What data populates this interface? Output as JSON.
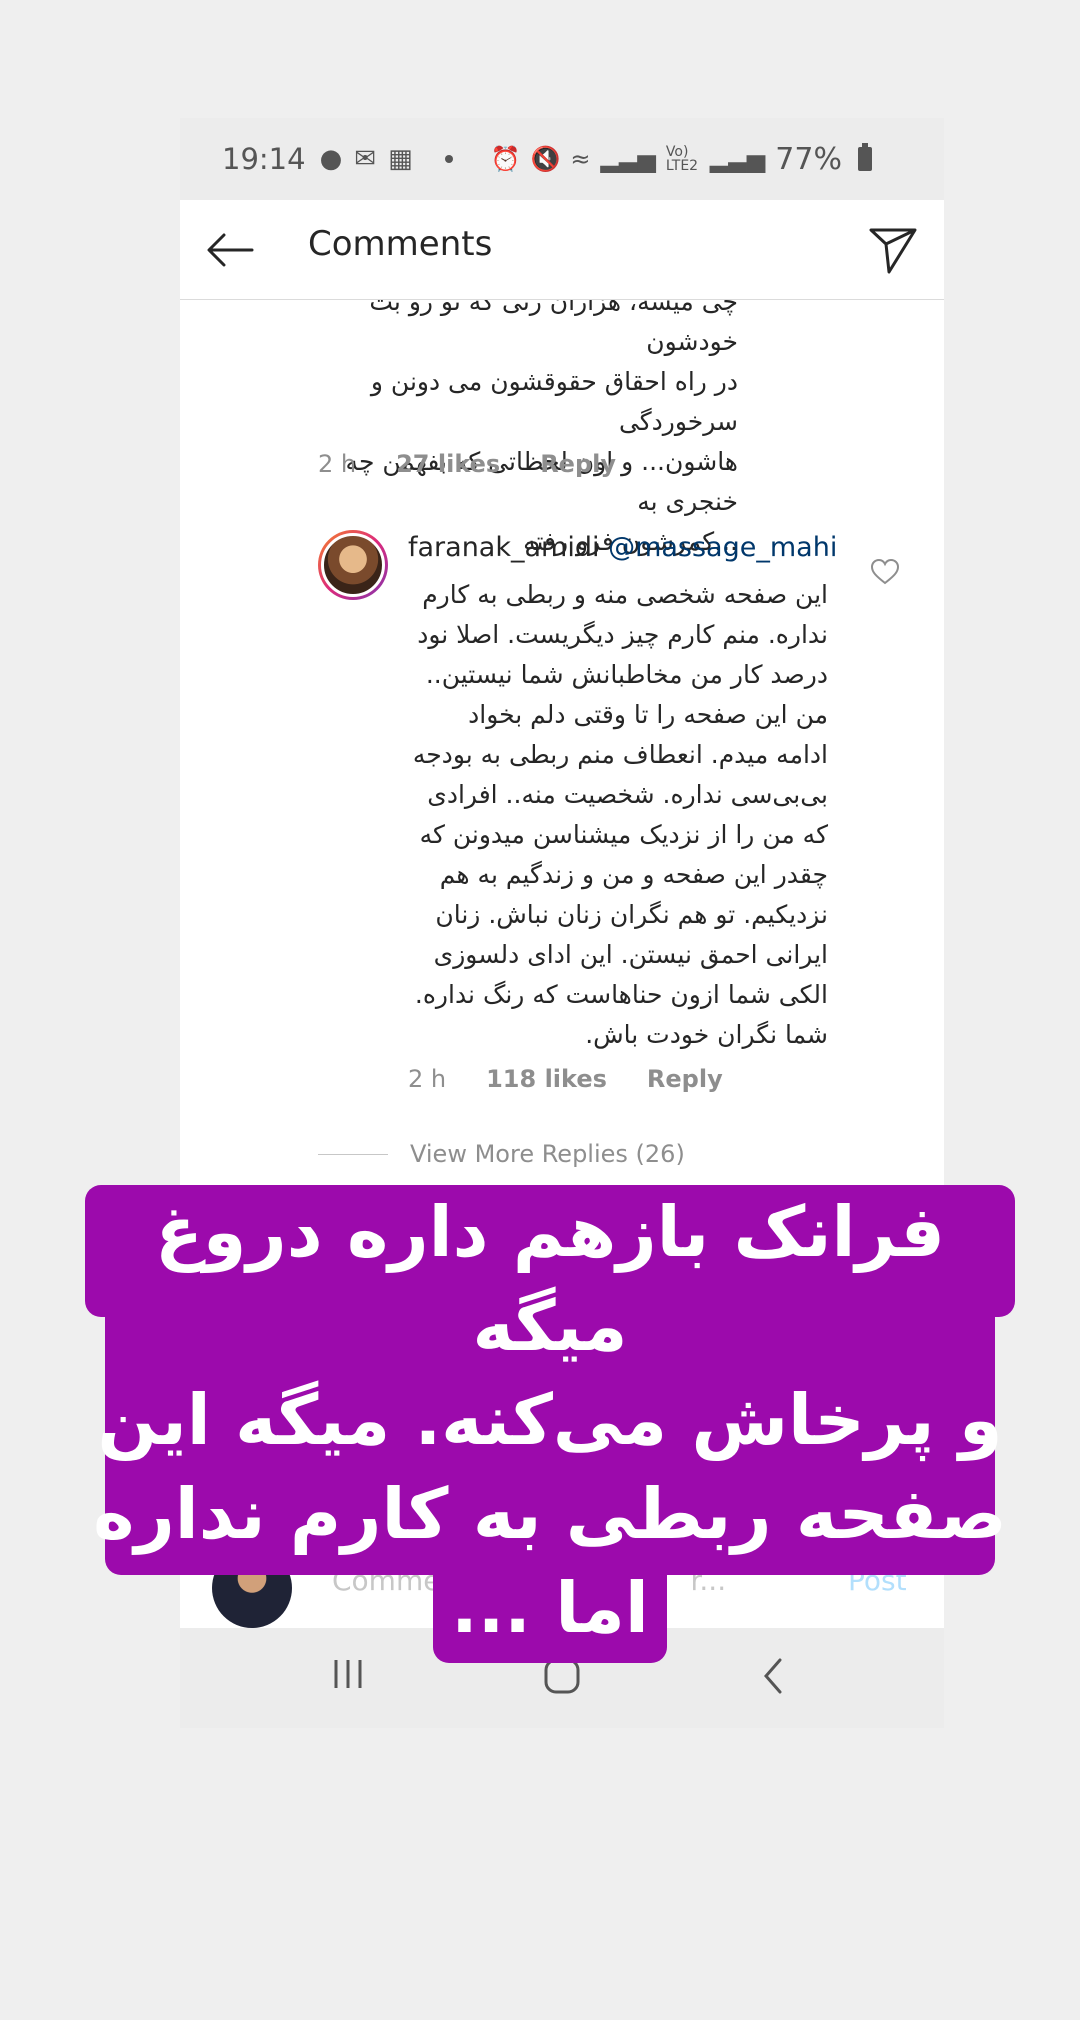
{
  "status_bar": {
    "time": "19:14",
    "battery_percent": "77%",
    "network_label": "Vo) LTE2"
  },
  "header": {
    "title": "Comments"
  },
  "previous_comment": {
    "lines": [
      "چی میشه، هزاران زنی که تو رو بت خودشون",
      "در راه احقاق حقوقشون می دونن و سرخوردگی",
      "هاشون... و اون لحظاتی که بفهمن چه خنجری به",
      "...کمرشون فرو رفته"
    ],
    "time": "2 h",
    "likes": "27 likes",
    "reply_label": "Reply"
  },
  "reply_comment": {
    "username": "faranak_amidi",
    "mention": "@massage_mahi",
    "lines": [
      "این صفحه شخصی منه و ربطی به کارم",
      "نداره. منم کارم چیز دیگریست. اصلا نود",
      "درصد کار من مخاطبانش شما نیستین..",
      "من این صفحه را تا وقتی دلم بخواد",
      "ادامه میدم.  انعطاف منم ربطی به بودجه",
      "بی‌بی‌سی نداره. شخصیت منه.. افرادی",
      "که من را از نزدیک میشناسن میدونن که",
      "چقدر این صفحه و من و زندگیم به هم",
      "نزدیکیم. تو هم نگران زنان نباش. زنان",
      "ایرانی احمق نیستن. این ادای دلسوزی",
      "الکی شما ازون حناهاست که رنگ نداره.",
      "شما نگران خودت باش."
    ],
    "time": "2 h",
    "likes": "118 likes",
    "reply_label": "Reply"
  },
  "view_more_replies": "View More Replies (26)",
  "composer": {
    "placeholder_visible": "Comme",
    "placeholder_tail": "r...",
    "post_label": "Post"
  },
  "overlay_caption": {
    "lines": [
      "فرانک بازهم داره دروغ میگه",
      "و پرخاش می‌کنه. میگه این",
      "صفحه ربطی به کارم نداره",
      "اما ..."
    ],
    "color": "#9c0aac"
  },
  "icons": [
    "back-arrow-icon",
    "send-icon",
    "heart-icon",
    "recent-apps-icon",
    "home-icon",
    "nav-back-icon"
  ]
}
